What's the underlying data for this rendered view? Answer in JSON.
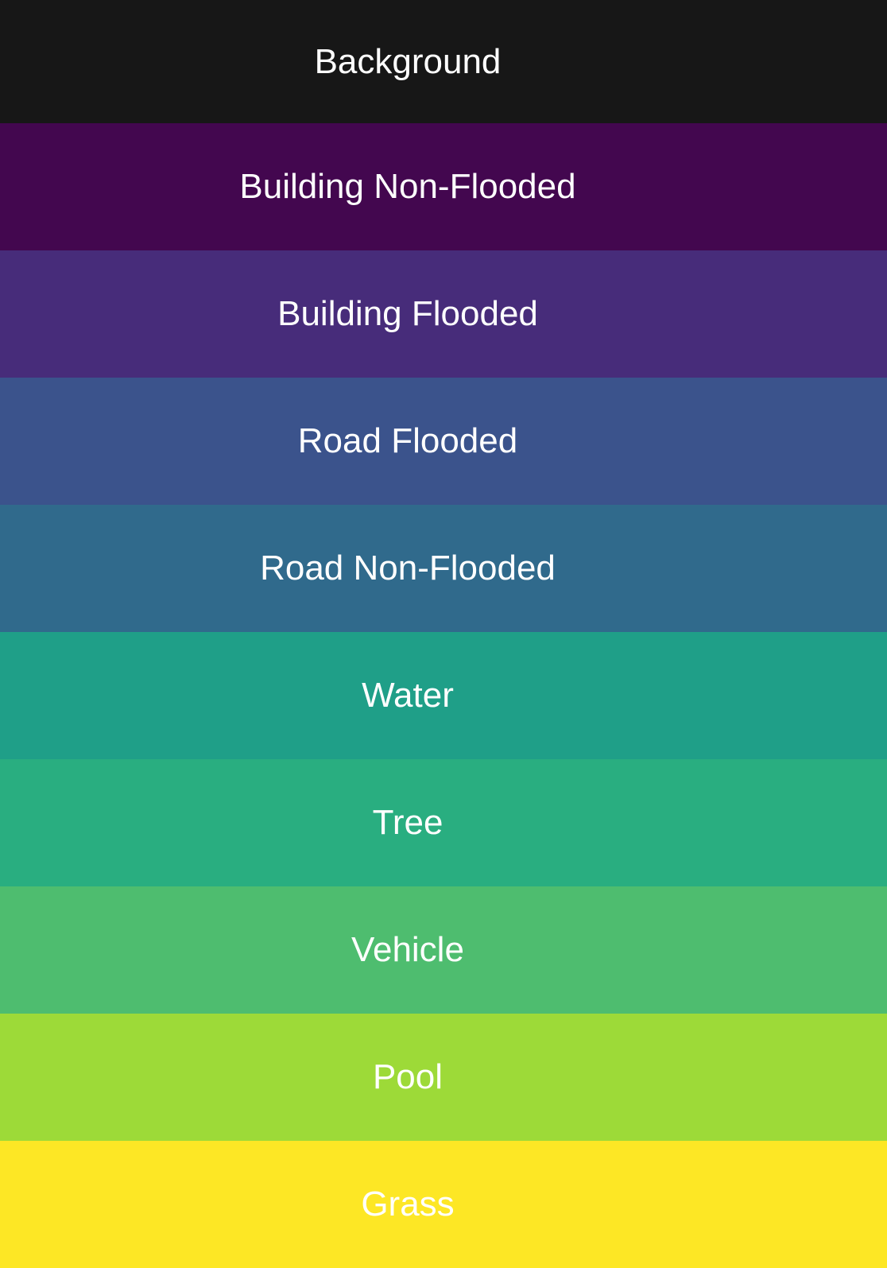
{
  "legend": {
    "classes": [
      {
        "label": "Background",
        "color": "#171717"
      },
      {
        "label": "Building Non-Flooded",
        "color": "#43074f"
      },
      {
        "label": "Building Flooded",
        "color": "#472c7a"
      },
      {
        "label": "Road Flooded",
        "color": "#3b538c"
      },
      {
        "label": "Road Non-Flooded",
        "color": "#306a8c"
      },
      {
        "label": "Water",
        "color": "#1f9f88"
      },
      {
        "label": "Tree",
        "color": "#29ae80"
      },
      {
        "label": "Vehicle",
        "color": "#4ebd6f"
      },
      {
        "label": "Pool",
        "color": "#9dda38"
      },
      {
        "label": "Grass",
        "color": "#fde725"
      }
    ]
  }
}
